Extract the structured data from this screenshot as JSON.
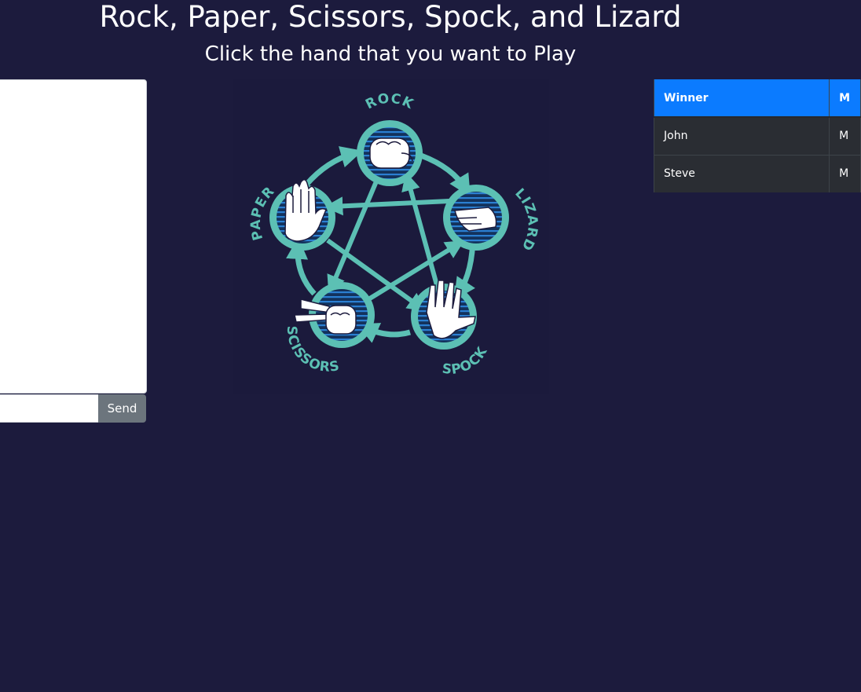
{
  "header": {
    "title": "Rock, Paper, Scissors, Spock, and Lizard",
    "subtitle": "Click the hand that you want to Play"
  },
  "chat": {
    "input_value": "",
    "send_label": "Send"
  },
  "board": {
    "hands": [
      {
        "key": "rock",
        "label": "ROCK"
      },
      {
        "key": "lizard",
        "label": "LIZARD"
      },
      {
        "key": "spock",
        "label": "SPOCK"
      },
      {
        "key": "scissors",
        "label": "SCISSORS"
      },
      {
        "key": "paper",
        "label": "PAPER"
      }
    ],
    "colors": {
      "ring": "#5cc0b4",
      "circle_fill": "#13325c",
      "stripes": "#2b7fd2",
      "hand": "#ffffff"
    }
  },
  "scoreboard": {
    "headers": [
      "Winner",
      "M"
    ],
    "rows": [
      [
        "John",
        "M"
      ],
      [
        "Steve",
        "M"
      ]
    ]
  }
}
